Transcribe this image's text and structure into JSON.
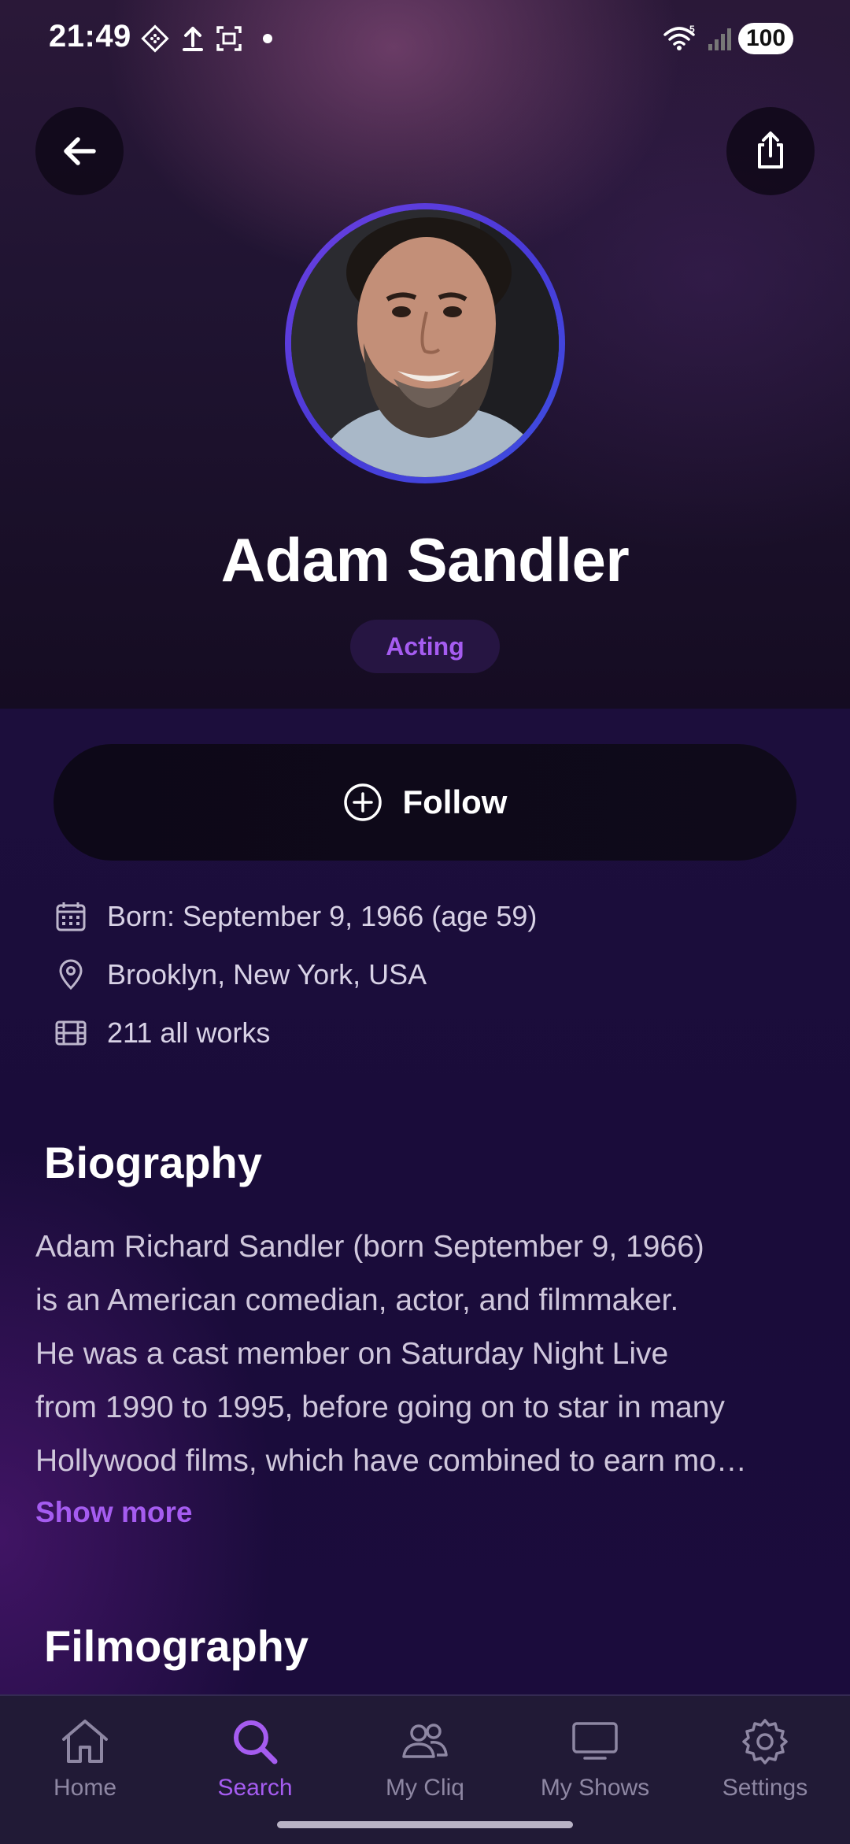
{
  "status_bar": {
    "time": "21:49",
    "battery": "100",
    "icons": [
      "diamond-icon",
      "upload-icon",
      "screenshot-icon",
      "dot-icon",
      "wifi-icon",
      "signal-icon"
    ]
  },
  "header": {
    "back_icon": "back-arrow-icon",
    "share_icon": "share-icon"
  },
  "profile": {
    "name": "Adam Sandler",
    "department": "Acting"
  },
  "follow": {
    "label": "Follow",
    "icon": "plus-circle-icon"
  },
  "info": {
    "born": "Born: September 9, 1966 (age 59)",
    "place": "Brooklyn, New York, USA",
    "works": "211 all works"
  },
  "biography": {
    "title": "Biography",
    "lines": [
      "Adam Richard Sandler (born September 9, 1966)",
      "is an American comedian, actor, and filmmaker.",
      "He was a cast member on Saturday Night Live",
      "from 1990 to 1995, before going on to star in many",
      "Hollywood films, which have combined to earn mo…"
    ],
    "show_more": "Show more"
  },
  "filmography": {
    "title": "Filmography"
  },
  "bottom_nav": {
    "items": [
      {
        "label": "Home",
        "icon": "home-icon",
        "active": false
      },
      {
        "label": "Search",
        "icon": "search-icon",
        "active": true
      },
      {
        "label": "My Cliq",
        "icon": "people-icon",
        "active": false
      },
      {
        "label": "My Shows",
        "icon": "tv-icon",
        "active": false
      },
      {
        "label": "Settings",
        "icon": "gear-icon",
        "active": false
      }
    ]
  },
  "colors": {
    "accent": "#a55cf0",
    "background": "#1a0c36",
    "nav_background": "#211a36"
  }
}
